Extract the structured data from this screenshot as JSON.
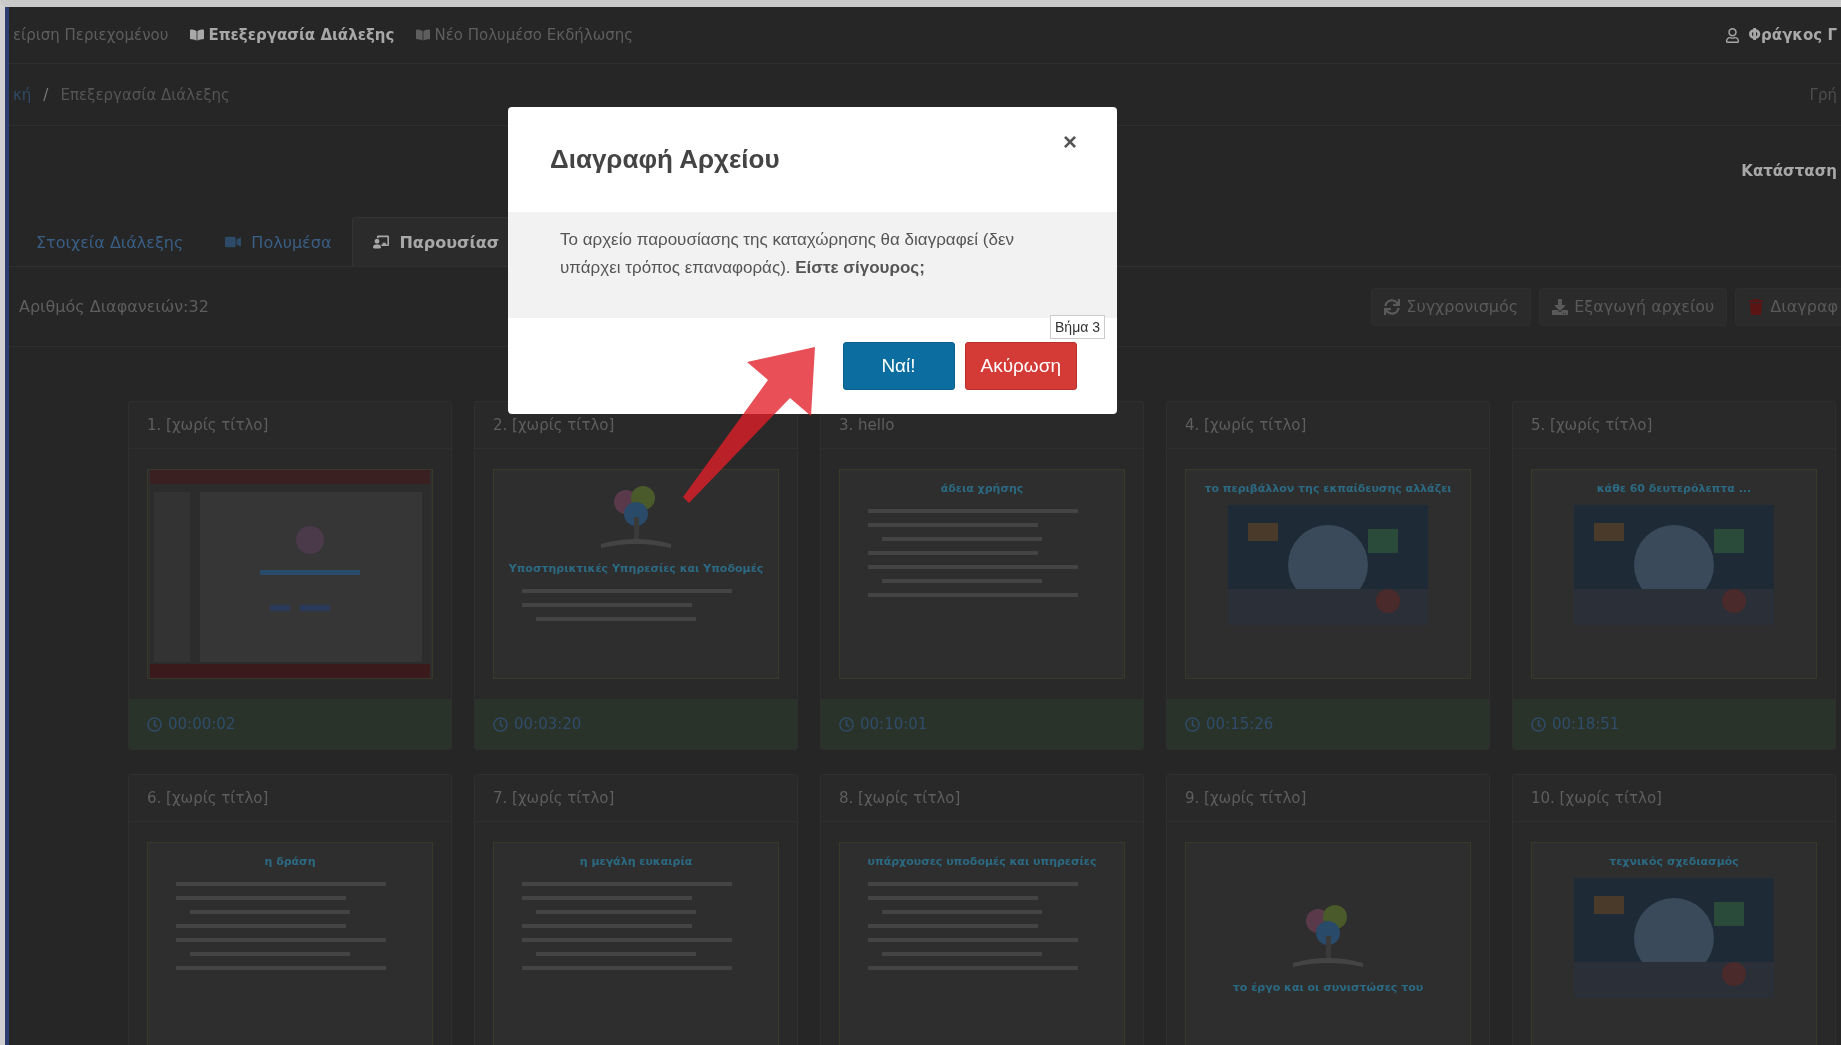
{
  "nav": {
    "items": [
      {
        "text": "είριση Περιεχομένου",
        "kind": "plain",
        "bold": false
      },
      {
        "text": "Επεξεργασία Διάλεξης",
        "kind": "book",
        "bold": true
      },
      {
        "text": "Νέο Πολυμέσο Εκδήλωσης",
        "kind": "book",
        "bold": false
      }
    ],
    "user": "Φράγκος Γ"
  },
  "breadcrumb": {
    "items": [
      "κή",
      "Επεξεργασία Διάλεξης"
    ],
    "separator": "/",
    "right": "Γρή"
  },
  "status_label": "Κατάσταση",
  "tabs": [
    {
      "label": "Στοιχεία Διάλεξης",
      "kind": "plain",
      "selected": false
    },
    {
      "label": "Πολυμέσα",
      "kind": "video",
      "selected": false
    },
    {
      "label": "Παρουσίασ",
      "kind": "presentation",
      "selected": true
    }
  ],
  "slide_count": "Αριθμός Διαφανειών:32",
  "actions": [
    {
      "label": "Συγχρονισμός",
      "kind": "sync"
    },
    {
      "label": "Εξαγωγή αρχείου",
      "kind": "download"
    },
    {
      "label": "Διαγραφ",
      "kind": "trash"
    }
  ],
  "slides": [
    {
      "title": "1. [χωρίς τίτλο]",
      "time": "00:00:02",
      "kind": "picture"
    },
    {
      "title": "2. [χωρίς τίτλο]",
      "time": "00:03:20",
      "kind": "cover",
      "heading": "Υποστηρικτικές Υπηρεσίες και Υποδομές"
    },
    {
      "title": "3. hello",
      "time": "00:10:01",
      "kind": "bullets",
      "heading": "άδεια χρήσης"
    },
    {
      "title": "4. [χωρίς τίτλο]",
      "time": "00:15:26",
      "heading": "το περιβάλλον της εκπαίδευσης αλλάζει"
    },
    {
      "title": "5. [χωρίς τίτλο]",
      "time": "00:18:51",
      "heading": "κάθε 60 δευτερόλεπτα ..."
    },
    {
      "title": "6. [χωρίς τίτλο]",
      "kind": "bullets",
      "heading": "η δράση"
    },
    {
      "title": "7. [χωρίς τίτλο]",
      "kind": "bullets",
      "heading": "η μεγάλη ευκαιρία"
    },
    {
      "title": "8. [χωρίς τίτλο]",
      "kind": "bullets",
      "heading": "υπάρχουσες υποδομές και υπηρεσίες"
    },
    {
      "title": "9. [χωρίς τίτλο]",
      "kind": "tree",
      "heading": "το έργο και οι συνιστώσες του"
    },
    {
      "title": "10. [χωρίς τίτλο]",
      "heading": "τεχνικός σχεδιασμός"
    }
  ],
  "modal": {
    "title": "Διαγραφή Αρχείου",
    "close": "×",
    "message": "Το αρχείο παρουσίασης της καταχώρησης θα διαγραφεί (δεν υπάρχει τρόπος επαναφοράς). **Είστε σίγουρος;**",
    "buttons": [
      {
        "label": "Ναί!",
        "kind": "primary"
      },
      {
        "label": "Ακύρωση",
        "kind": "danger"
      }
    ],
    "tooltip": "Βήμα 3"
  }
}
